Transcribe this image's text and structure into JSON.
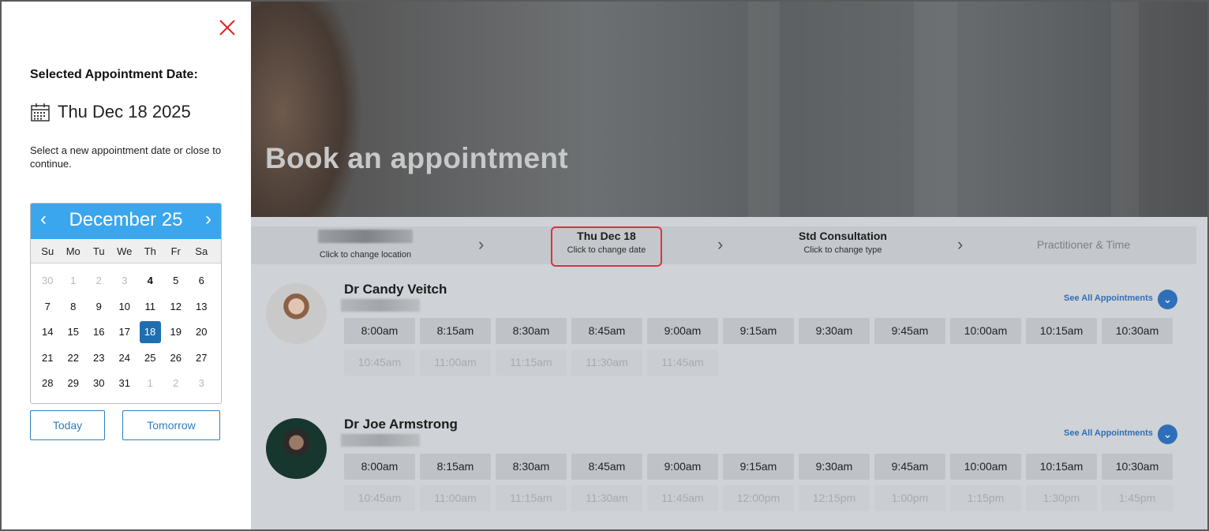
{
  "panel": {
    "selected_label": "Selected Appointment Date:",
    "selected_date": "Thu Dec 18 2025",
    "hint": "Select a new appointment date or close to continue.",
    "today_label": "Today",
    "tomorrow_label": "Tomorrow",
    "close_color": "#e02424"
  },
  "calendar": {
    "title": "December 25",
    "prev": "‹",
    "next": "›",
    "dow": [
      "Su",
      "Mo",
      "Tu",
      "We",
      "Th",
      "Fr",
      "Sa"
    ],
    "weeks": [
      [
        "30",
        "1",
        "2",
        "3",
        "4",
        "5",
        "6"
      ],
      [
        "7",
        "8",
        "9",
        "10",
        "11",
        "12",
        "13"
      ],
      [
        "14",
        "15",
        "16",
        "17",
        "18",
        "19",
        "20"
      ],
      [
        "21",
        "22",
        "23",
        "24",
        "25",
        "26",
        "27"
      ],
      [
        "28",
        "29",
        "30",
        "31",
        "1",
        "2",
        "3"
      ]
    ],
    "selected_day": "18",
    "header_color": "#3aa6ee",
    "selected_color": "#1f6fb0"
  },
  "hero": {
    "title": "Book an appointment"
  },
  "steps": {
    "location_sub": "Click to change location",
    "date_title": "Thu Dec 18",
    "date_sub": "Click to change date",
    "type_title": "Std Consultation",
    "type_sub": "Click to change type",
    "practitioner": "Practitioner & Time",
    "chevron": "›"
  },
  "doctors": [
    {
      "name": "Dr Candy Veitch",
      "see_all": "See All Appointments",
      "slots_available": [
        "8:00am",
        "8:15am",
        "8:30am",
        "8:45am",
        "9:00am",
        "9:15am",
        "9:30am",
        "9:45am",
        "10:00am",
        "10:15am",
        "10:30am"
      ],
      "slots_unavailable": [
        "10:45am",
        "11:00am",
        "11:15am",
        "11:30am",
        "11:45am"
      ]
    },
    {
      "name": "Dr Joe Armstrong",
      "see_all": "See All Appointments",
      "slots_available": [
        "8:00am",
        "8:15am",
        "8:30am",
        "8:45am",
        "9:00am",
        "9:15am",
        "9:30am",
        "9:45am",
        "10:00am",
        "10:15am",
        "10:30am"
      ],
      "slots_unavailable": [
        "10:45am",
        "11:00am",
        "11:15am",
        "11:30am",
        "11:45am",
        "12:00pm",
        "12:15pm",
        "1:00pm",
        "1:15pm",
        "1:30pm",
        "1:45pm"
      ]
    }
  ],
  "icons": {
    "close": "close-icon",
    "calendar": "calendar-icon",
    "expand": "chevron-down-icon"
  }
}
